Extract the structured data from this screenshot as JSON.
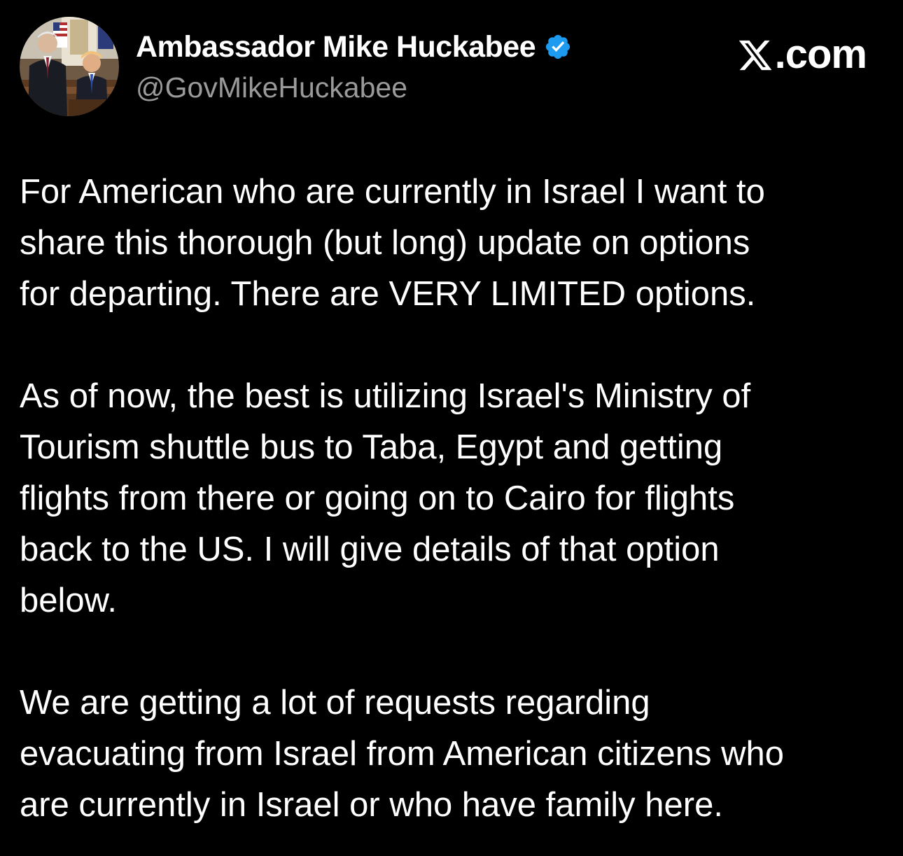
{
  "post": {
    "author": {
      "display_name": "Ambassador Mike Huckabee",
      "handle": "@GovMikeHuckabee",
      "verified": true,
      "verified_icon": "verified-badge-icon",
      "avatar": "profile-photo"
    },
    "brand": {
      "label": ".com",
      "icon": "x-logo-icon"
    },
    "paragraphs": [
      "For American who are currently in Israel I want to\nshare this thorough (but long) update on options\nfor departing.  There are VERY LIMITED options.",
      "As of now, the best is utilizing Israel's Ministry of\nTourism shuttle bus to Taba, Egypt and getting\nflights from there or going on to Cairo for flights\nback to the US. I will give details of that option\nbelow.",
      "We are getting a lot of requests regarding\nevacuating from Israel from American citizens who\nare currently in Israel or who have family here."
    ]
  },
  "colors": {
    "background": "#000000",
    "text": "#ffffff",
    "handle": "#9a9a9a",
    "verified_badge": "#1d9bf0"
  }
}
